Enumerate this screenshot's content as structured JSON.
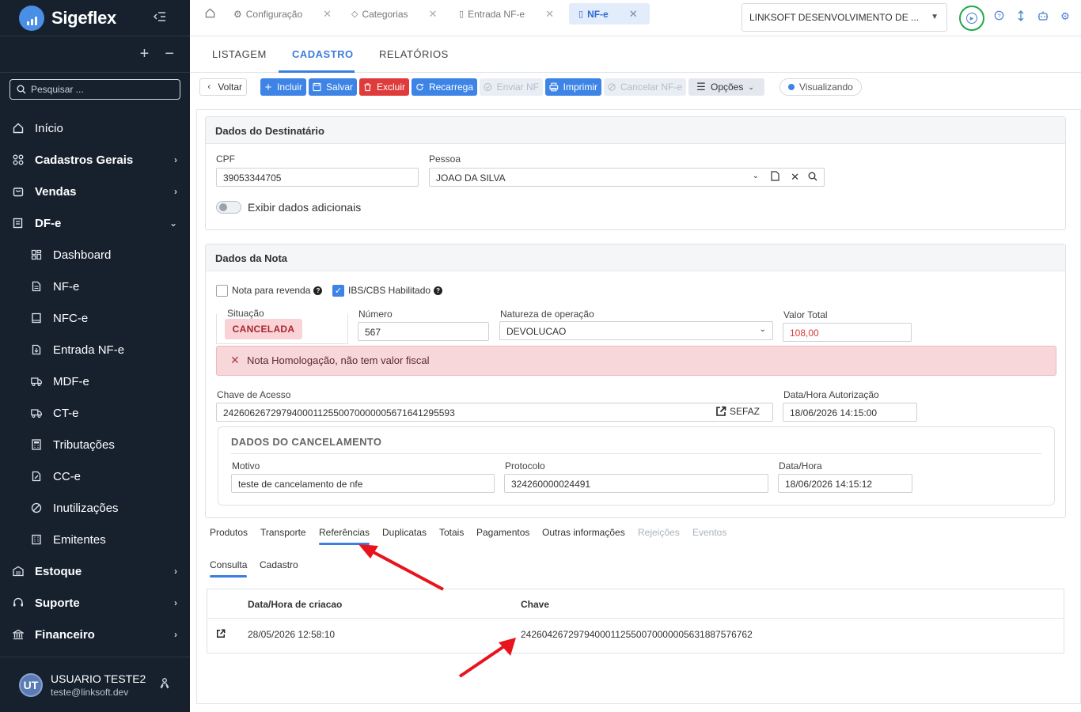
{
  "sidebar": {
    "brand": "Sigeflex",
    "search_placeholder": "Pesquisar ...",
    "items": [
      {
        "label": "Início"
      },
      {
        "label": "Cadastros Gerais"
      },
      {
        "label": "Vendas"
      },
      {
        "label": "DF-e"
      },
      {
        "label": "Dashboard"
      },
      {
        "label": "NF-e"
      },
      {
        "label": "NFC-e"
      },
      {
        "label": "Entrada NF-e"
      },
      {
        "label": "MDF-e"
      },
      {
        "label": "CT-e"
      },
      {
        "label": "Tributações"
      },
      {
        "label": "CC-e"
      },
      {
        "label": "Inutilizações"
      },
      {
        "label": "Emitentes"
      },
      {
        "label": "Estoque"
      },
      {
        "label": "Suporte"
      },
      {
        "label": "Financeiro"
      }
    ],
    "user": {
      "initials": "UT",
      "name": "USUARIO TESTE2",
      "email": "teste@linksoft.dev"
    }
  },
  "tabs": [
    {
      "label": "Configuração"
    },
    {
      "label": "Categorias"
    },
    {
      "label": "Entrada NF-e"
    },
    {
      "label": "NF-e"
    }
  ],
  "company": "LINKSOFT DESENVOLVIMENTO DE ...",
  "subnav": {
    "listagem": "LISTAGEM",
    "cadastro": "CADASTRO",
    "relatorios": "RELATÓRIOS"
  },
  "toolbar": {
    "voltar": "Voltar",
    "incluir": "Incluir",
    "salvar": "Salvar",
    "excluir": "Excluir",
    "recarrega": "Recarrega",
    "enviar": "Enviar NF",
    "imprimir": "Imprimir",
    "cancelar": "Cancelar NF-e",
    "opcoes": "Opções",
    "status": "Visualizando"
  },
  "destinatario": {
    "title": "Dados do Destinatário",
    "cpf_label": "CPF",
    "cpf": "39053344705",
    "pessoa_label": "Pessoa",
    "pessoa": "JOAO DA SILVA",
    "exibir": "Exibir dados adicionais"
  },
  "nota": {
    "title": "Dados da Nota",
    "revenda": "Nota para revenda",
    "ibs": "IBS/CBS Habilitado",
    "situacao_label": "Situação",
    "situacao": "CANCELADA",
    "numero_label": "Número",
    "numero": "567",
    "natureza_label": "Natureza de operação",
    "natureza": "DEVOLUCAO",
    "valor_label": "Valor Total",
    "valor": "108,00",
    "alert": "Nota Homologação, não tem valor fiscal",
    "chave_label": "Chave de Acesso",
    "chave": "24260626729794000112550070000005671641295593",
    "sefaz": "SEFAZ",
    "autorizacao_label": "Data/Hora Autorização",
    "autorizacao": "18/06/2026 14:15:00",
    "cancel_title": "DADOS DO CANCELAMENTO",
    "motivo_label": "Motivo",
    "motivo": "teste de cancelamento de nfe",
    "protocolo_label": "Protocolo",
    "protocolo": "324260000024491",
    "datahora_label": "Data/Hora",
    "datahora": "18/06/2026 14:15:12"
  },
  "detail_tabs": [
    "Produtos",
    "Transporte",
    "Referências",
    "Duplicatas",
    "Totais",
    "Pagamentos",
    "Outras informações",
    "Rejeições",
    "Eventos"
  ],
  "ref_tabs": [
    "Consulta",
    "Cadastro"
  ],
  "ref_table": {
    "headers": [
      "Data/Hora de criacao",
      "Chave"
    ],
    "rows": [
      {
        "data": "28/05/2026 12:58:10",
        "chave": "24260426729794000112550070000005631887576762"
      }
    ]
  },
  "colors": {
    "sidebar": "#17212e",
    "primary": "#3d84e6",
    "danger": "#df3b3b",
    "arrow": "#e8141c"
  }
}
